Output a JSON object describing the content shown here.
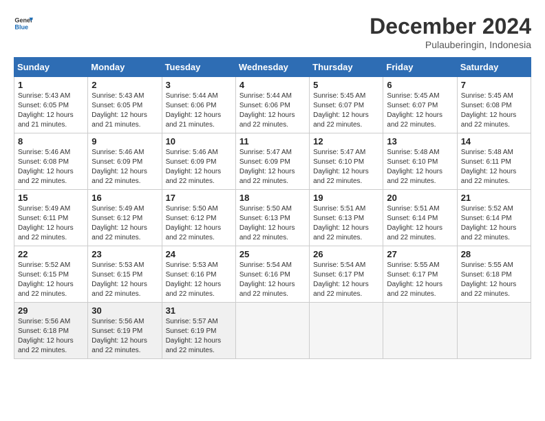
{
  "header": {
    "logo_line1": "General",
    "logo_line2": "Blue",
    "title": "December 2024",
    "subtitle": "Pulauberingin, Indonesia"
  },
  "calendar": {
    "days_of_week": [
      "Sunday",
      "Monday",
      "Tuesday",
      "Wednesday",
      "Thursday",
      "Friday",
      "Saturday"
    ],
    "weeks": [
      [
        {
          "day": "1",
          "info": "Sunrise: 5:43 AM\nSunset: 6:05 PM\nDaylight: 12 hours\nand 21 minutes."
        },
        {
          "day": "2",
          "info": "Sunrise: 5:43 AM\nSunset: 6:05 PM\nDaylight: 12 hours\nand 21 minutes."
        },
        {
          "day": "3",
          "info": "Sunrise: 5:44 AM\nSunset: 6:06 PM\nDaylight: 12 hours\nand 21 minutes."
        },
        {
          "day": "4",
          "info": "Sunrise: 5:44 AM\nSunset: 6:06 PM\nDaylight: 12 hours\nand 22 minutes."
        },
        {
          "day": "5",
          "info": "Sunrise: 5:45 AM\nSunset: 6:07 PM\nDaylight: 12 hours\nand 22 minutes."
        },
        {
          "day": "6",
          "info": "Sunrise: 5:45 AM\nSunset: 6:07 PM\nDaylight: 12 hours\nand 22 minutes."
        },
        {
          "day": "7",
          "info": "Sunrise: 5:45 AM\nSunset: 6:08 PM\nDaylight: 12 hours\nand 22 minutes."
        }
      ],
      [
        {
          "day": "8",
          "info": "Sunrise: 5:46 AM\nSunset: 6:08 PM\nDaylight: 12 hours\nand 22 minutes."
        },
        {
          "day": "9",
          "info": "Sunrise: 5:46 AM\nSunset: 6:09 PM\nDaylight: 12 hours\nand 22 minutes."
        },
        {
          "day": "10",
          "info": "Sunrise: 5:46 AM\nSunset: 6:09 PM\nDaylight: 12 hours\nand 22 minutes."
        },
        {
          "day": "11",
          "info": "Sunrise: 5:47 AM\nSunset: 6:09 PM\nDaylight: 12 hours\nand 22 minutes."
        },
        {
          "day": "12",
          "info": "Sunrise: 5:47 AM\nSunset: 6:10 PM\nDaylight: 12 hours\nand 22 minutes."
        },
        {
          "day": "13",
          "info": "Sunrise: 5:48 AM\nSunset: 6:10 PM\nDaylight: 12 hours\nand 22 minutes."
        },
        {
          "day": "14",
          "info": "Sunrise: 5:48 AM\nSunset: 6:11 PM\nDaylight: 12 hours\nand 22 minutes."
        }
      ],
      [
        {
          "day": "15",
          "info": "Sunrise: 5:49 AM\nSunset: 6:11 PM\nDaylight: 12 hours\nand 22 minutes."
        },
        {
          "day": "16",
          "info": "Sunrise: 5:49 AM\nSunset: 6:12 PM\nDaylight: 12 hours\nand 22 minutes."
        },
        {
          "day": "17",
          "info": "Sunrise: 5:50 AM\nSunset: 6:12 PM\nDaylight: 12 hours\nand 22 minutes."
        },
        {
          "day": "18",
          "info": "Sunrise: 5:50 AM\nSunset: 6:13 PM\nDaylight: 12 hours\nand 22 minutes."
        },
        {
          "day": "19",
          "info": "Sunrise: 5:51 AM\nSunset: 6:13 PM\nDaylight: 12 hours\nand 22 minutes."
        },
        {
          "day": "20",
          "info": "Sunrise: 5:51 AM\nSunset: 6:14 PM\nDaylight: 12 hours\nand 22 minutes."
        },
        {
          "day": "21",
          "info": "Sunrise: 5:52 AM\nSunset: 6:14 PM\nDaylight: 12 hours\nand 22 minutes."
        }
      ],
      [
        {
          "day": "22",
          "info": "Sunrise: 5:52 AM\nSunset: 6:15 PM\nDaylight: 12 hours\nand 22 minutes."
        },
        {
          "day": "23",
          "info": "Sunrise: 5:53 AM\nSunset: 6:15 PM\nDaylight: 12 hours\nand 22 minutes."
        },
        {
          "day": "24",
          "info": "Sunrise: 5:53 AM\nSunset: 6:16 PM\nDaylight: 12 hours\nand 22 minutes."
        },
        {
          "day": "25",
          "info": "Sunrise: 5:54 AM\nSunset: 6:16 PM\nDaylight: 12 hours\nand 22 minutes."
        },
        {
          "day": "26",
          "info": "Sunrise: 5:54 AM\nSunset: 6:17 PM\nDaylight: 12 hours\nand 22 minutes."
        },
        {
          "day": "27",
          "info": "Sunrise: 5:55 AM\nSunset: 6:17 PM\nDaylight: 12 hours\nand 22 minutes."
        },
        {
          "day": "28",
          "info": "Sunrise: 5:55 AM\nSunset: 6:18 PM\nDaylight: 12 hours\nand 22 minutes."
        }
      ],
      [
        {
          "day": "29",
          "info": "Sunrise: 5:56 AM\nSunset: 6:18 PM\nDaylight: 12 hours\nand 22 minutes."
        },
        {
          "day": "30",
          "info": "Sunrise: 5:56 AM\nSunset: 6:19 PM\nDaylight: 12 hours\nand 22 minutes."
        },
        {
          "day": "31",
          "info": "Sunrise: 5:57 AM\nSunset: 6:19 PM\nDaylight: 12 hours\nand 22 minutes."
        },
        {
          "day": "",
          "info": ""
        },
        {
          "day": "",
          "info": ""
        },
        {
          "day": "",
          "info": ""
        },
        {
          "day": "",
          "info": ""
        }
      ]
    ]
  }
}
